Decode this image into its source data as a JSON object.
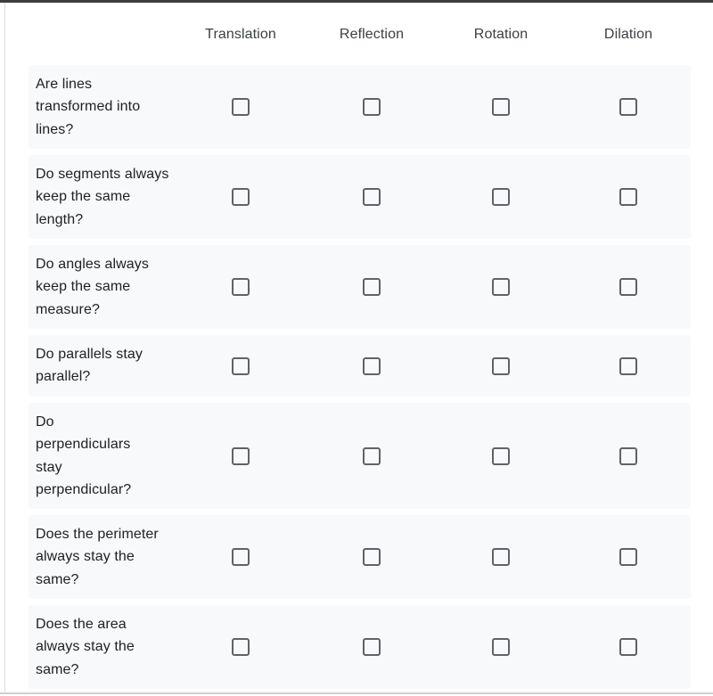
{
  "columns": [
    "Translation",
    "Reflection",
    "Rotation",
    "Dilation"
  ],
  "rows": [
    {
      "label": "Are lines transformed into lines?",
      "checked": [
        false,
        false,
        false,
        false
      ]
    },
    {
      "label": "Do segments always keep the same length?",
      "checked": [
        false,
        false,
        false,
        false
      ]
    },
    {
      "label": "Do angles always keep the same measure?",
      "checked": [
        false,
        false,
        false,
        false
      ]
    },
    {
      "label": "Do parallels stay parallel?",
      "checked": [
        false,
        false,
        false,
        false
      ]
    },
    {
      "label": "Do perpendiculars stay perpendicular?",
      "checked": [
        false,
        false,
        false,
        false
      ]
    },
    {
      "label": "Does the perimeter always stay the same?",
      "checked": [
        false,
        false,
        false,
        false
      ]
    },
    {
      "label": "Does the area always stay the same?",
      "checked": [
        false,
        false,
        false,
        false
      ]
    }
  ],
  "colors": {
    "row_background": "#f8f9fa",
    "checkbox_border": "#5f6368"
  }
}
